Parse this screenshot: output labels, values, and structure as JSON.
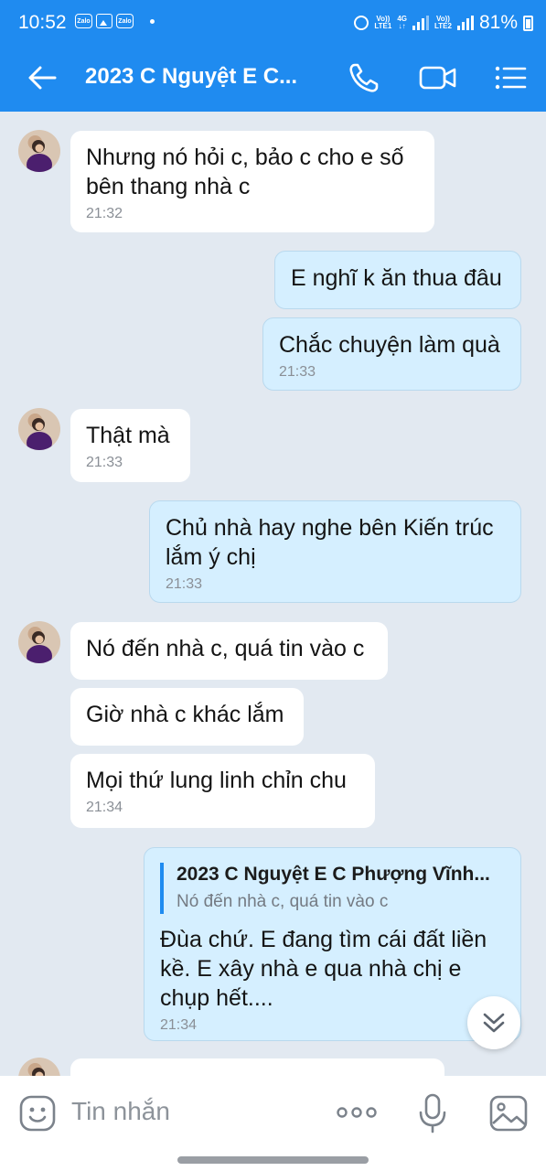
{
  "status_bar": {
    "time": "10:52",
    "app_icon_1": "Zalo",
    "app_icon_2": "Zalo",
    "network_1_top": "Vo))",
    "network_1_bottom": "LTE1",
    "network_gen": "4G",
    "network_2_top": "Vo))",
    "network_2_bottom": "LTE2",
    "battery": "81%"
  },
  "header": {
    "title": "2023 C Nguyệt E C..."
  },
  "messages": [
    {
      "text": "Nhưng nó hỏi c, bảo c cho e số bên thang nhà c",
      "time": "21:32"
    },
    {
      "text": "E nghĩ k ăn thua đâu"
    },
    {
      "text": "Chắc chuyện làm quà",
      "time": "21:33"
    },
    {
      "text": "Thật mà",
      "time": "21:33"
    },
    {
      "text": "Chủ nhà hay nghe bên Kiến trúc lắm ý chị",
      "time": "21:33"
    },
    {
      "text": "Nó đến nhà c, quá tin vào c"
    },
    {
      "text": "Giờ nhà c khác lắm"
    },
    {
      "text": "Mọi thứ lung linh chỉn chu",
      "time": "21:34"
    },
    {
      "quote_name": "2023 C Nguyệt E C Phượng Vĩnh...",
      "quote_text": "Nó đến nhà c, quá tin vào c",
      "text": "Đùa chứ. E đang tìm cái đất liền kề. E xây nhà e qua nhà chị e chụp hết....",
      "time": "21:34"
    }
  ],
  "input_bar": {
    "placeholder": "Tin nhắn"
  },
  "colors": {
    "header_bg": "#1f8bf0",
    "chat_bg": "#e2e9f1",
    "incoming_bubble": "#ffffff",
    "outgoing_bubble": "#d5efff",
    "quote_bar": "#1f8bf0"
  },
  "icons": [
    "back-arrow-icon",
    "phone-icon",
    "video-call-icon",
    "menu-list-icon",
    "chevron-double-down-icon",
    "emoji-icon",
    "more-dots-icon",
    "microphone-icon",
    "image-icon"
  ]
}
